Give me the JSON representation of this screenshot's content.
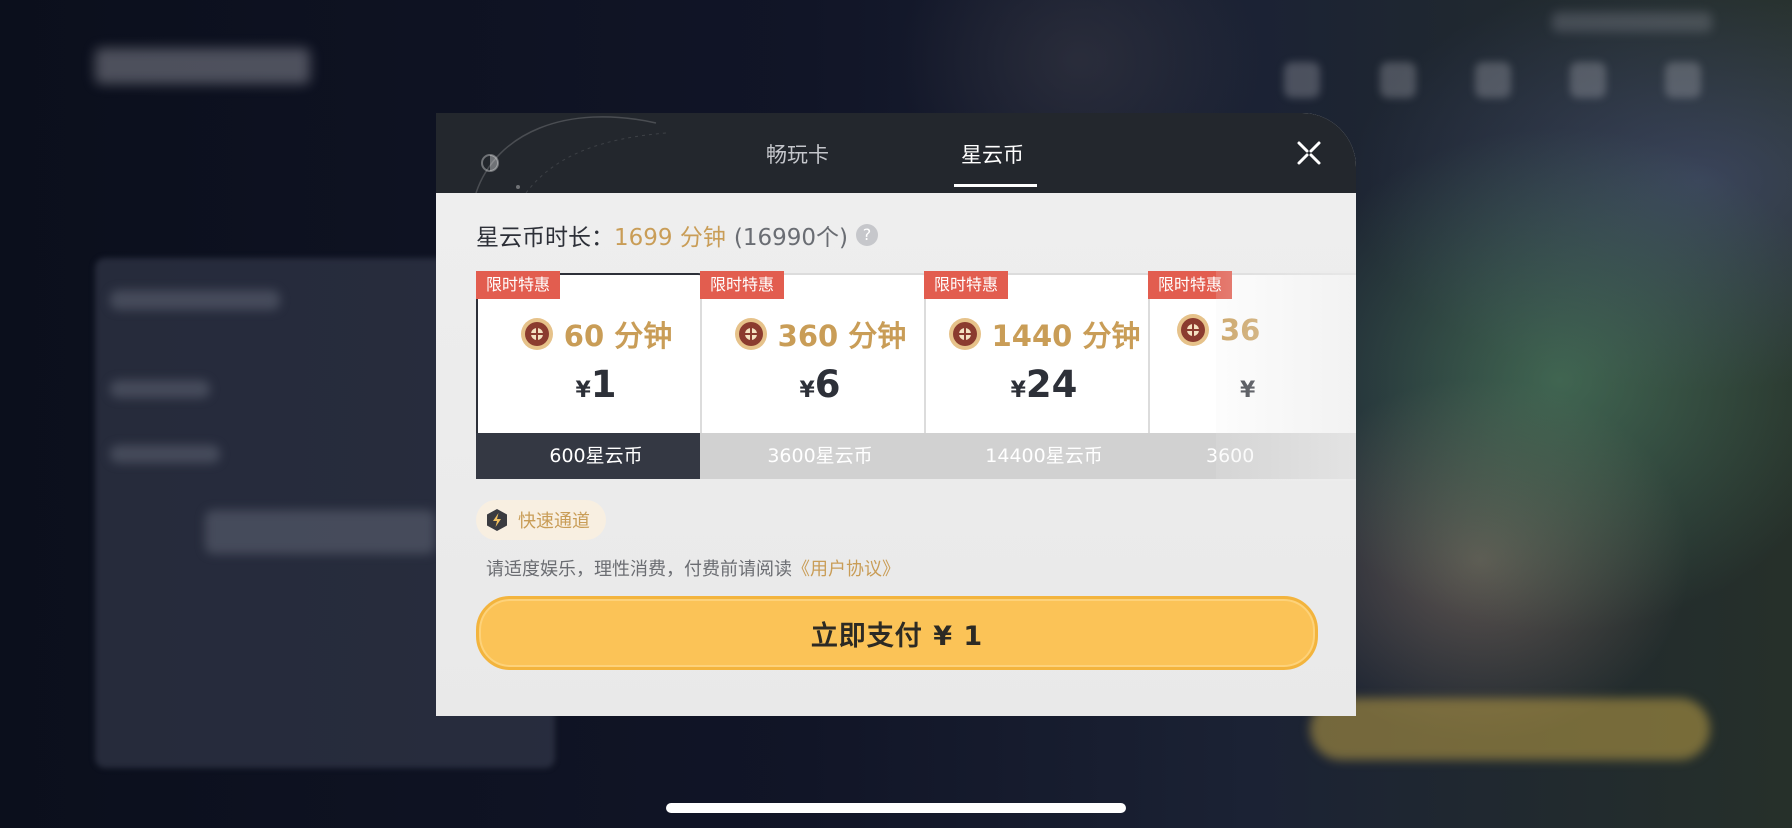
{
  "tabs": [
    {
      "label": "畅玩卡",
      "active": false
    },
    {
      "label": "星云币",
      "active": true
    }
  ],
  "balance": {
    "label": "星云币时长：",
    "minutes": "1699 分钟",
    "coins": "(16990个)",
    "help": "?"
  },
  "cards": [
    {
      "badge": "限时特惠",
      "minutes": "60 分钟",
      "currency": "¥",
      "price": "1",
      "coins": "600星云币",
      "selected": true
    },
    {
      "badge": "限时特惠",
      "minutes": "360 分钟",
      "currency": "¥",
      "price": "6",
      "coins": "3600星云币",
      "selected": false
    },
    {
      "badge": "限时特惠",
      "minutes": "1440 分钟",
      "currency": "¥",
      "price": "24",
      "coins": "14400星云币",
      "selected": false
    },
    {
      "badge": "限时特惠",
      "minutes": "36",
      "currency": "¥",
      "price": "",
      "coins": "3600",
      "selected": false
    }
  ],
  "fast_channel": "快速通道",
  "notice": {
    "text": "请适度娱乐，理性消费，付费前请阅读",
    "link": "《用户协议》"
  },
  "pay_button": "立即支付 ¥ 1",
  "colors": {
    "accent_gold": "#c99d57",
    "pay_yellow": "#fbc357",
    "badge_red": "#e25d4f",
    "header_dark": "#23272d"
  },
  "icons": [
    "close-icon",
    "help-icon",
    "coin-icon",
    "lightning-icon"
  ]
}
